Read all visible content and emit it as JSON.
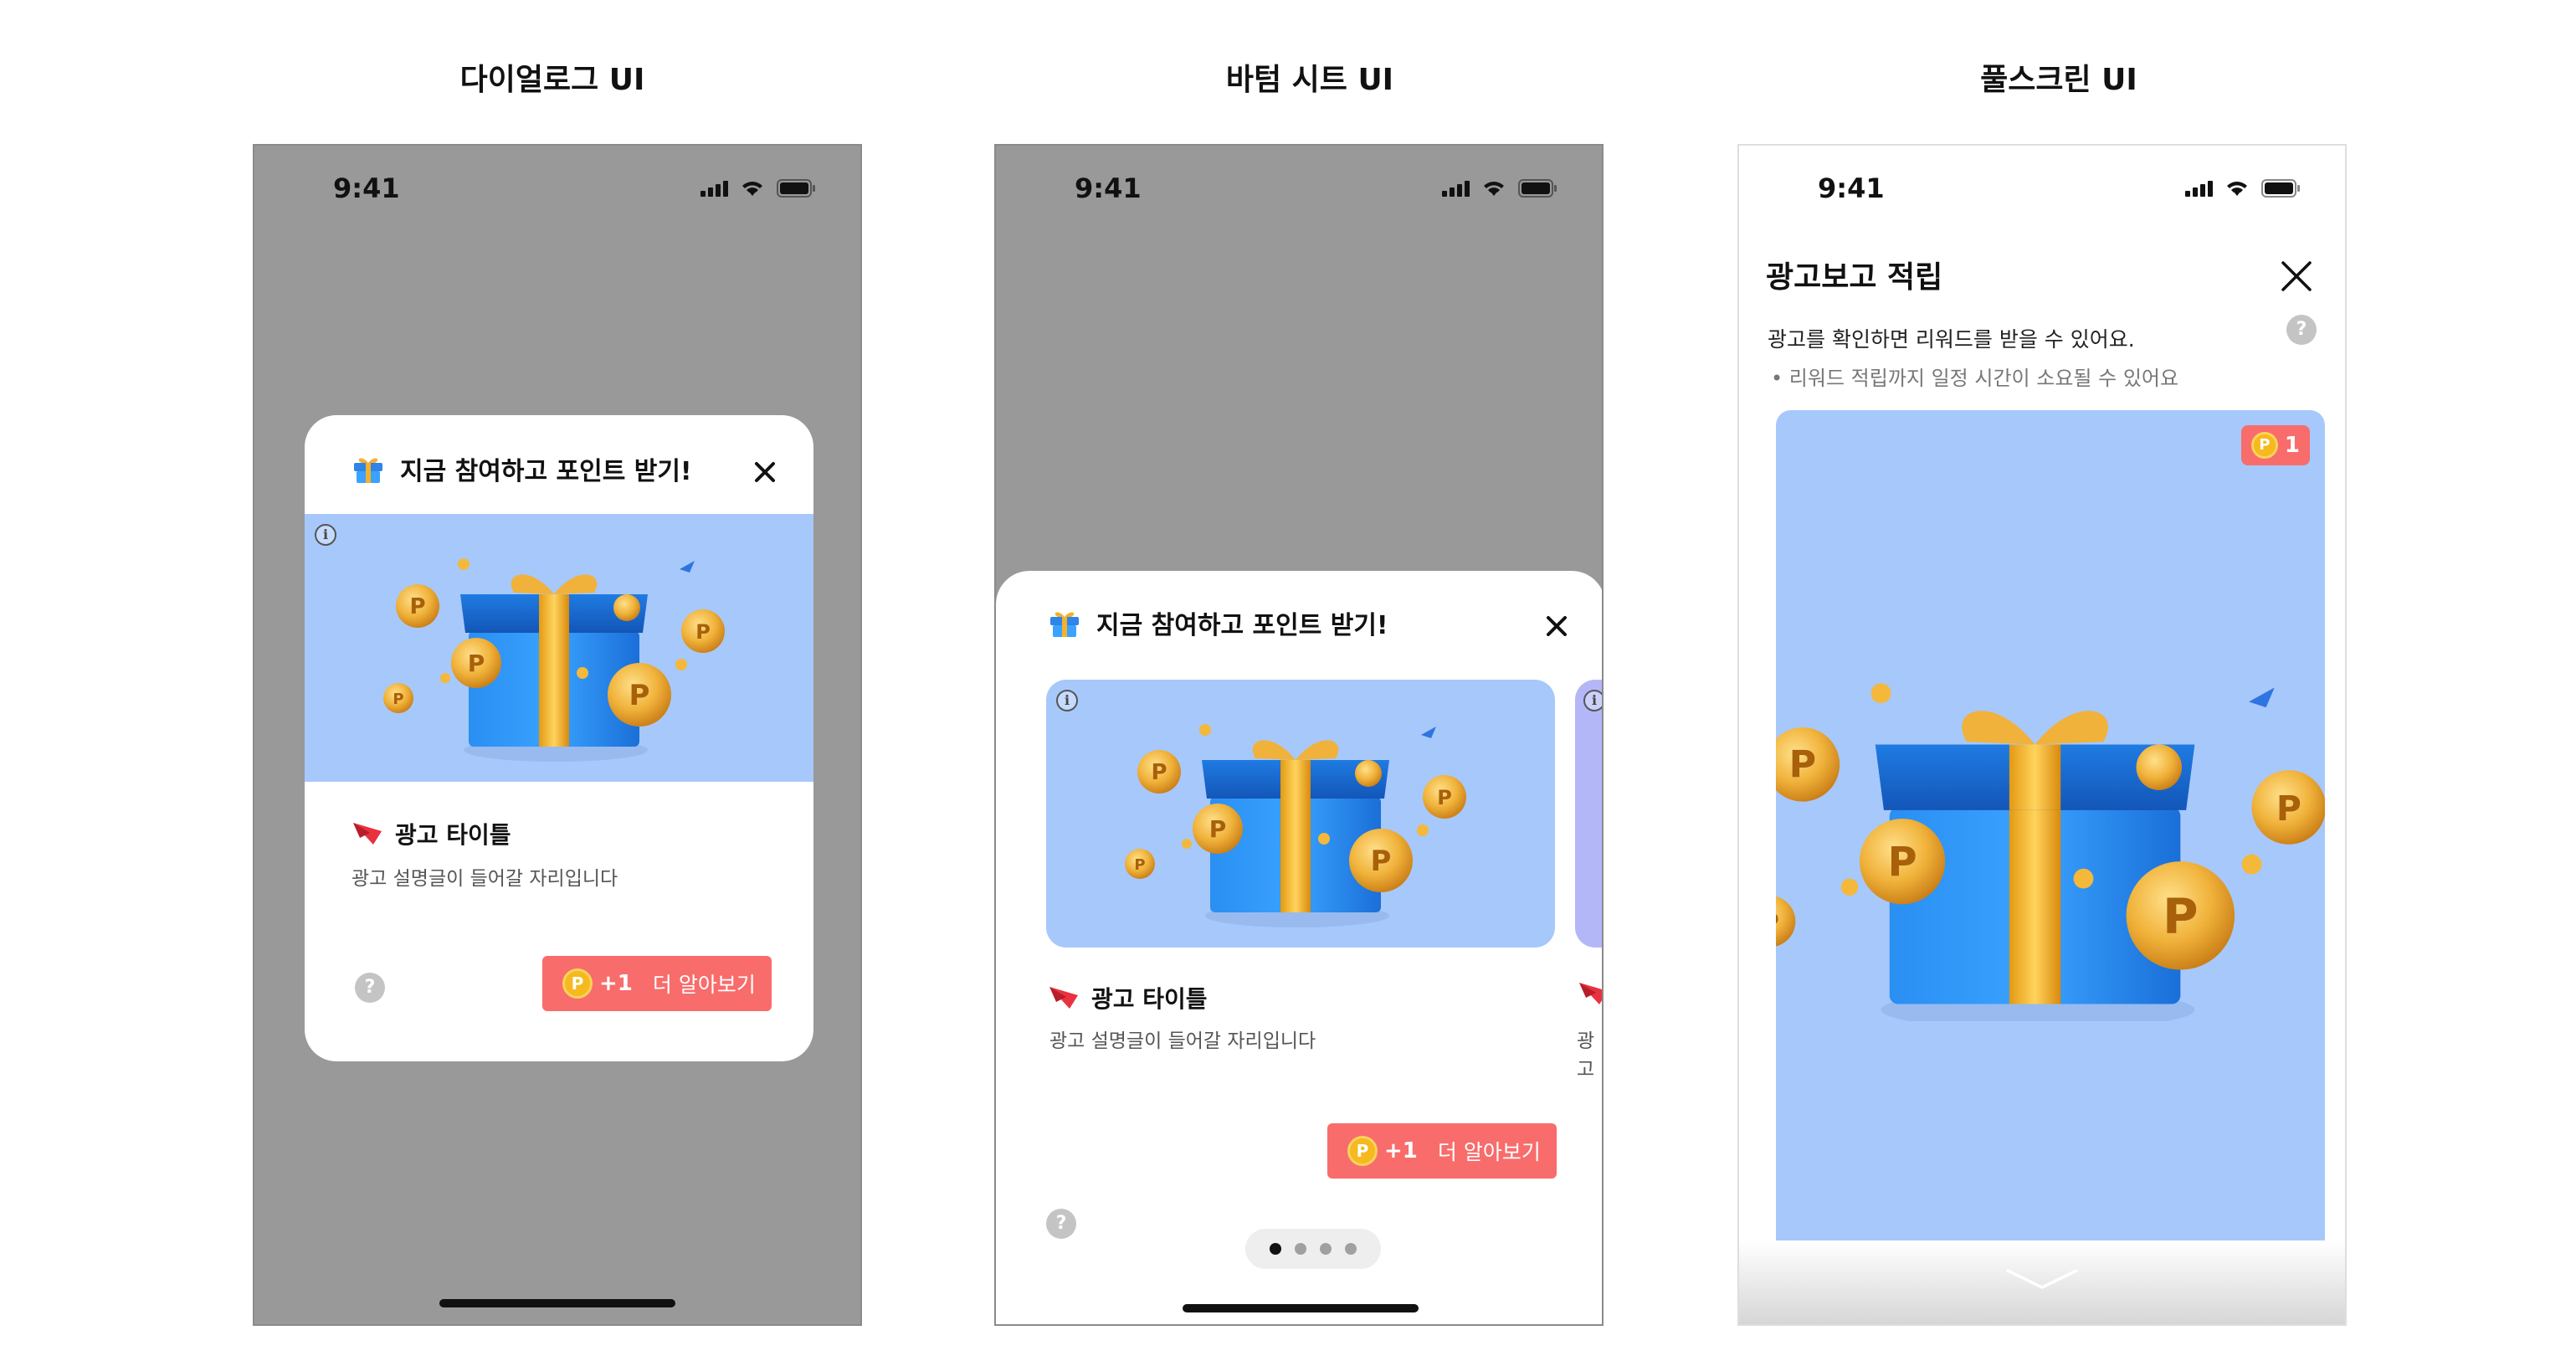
{
  "columns": [
    {
      "title": "다이얼로그 UI"
    },
    {
      "title": "바텀 시트 UI"
    },
    {
      "title": "풀스크린 UI"
    }
  ],
  "status_bar": {
    "time": "9:41"
  },
  "dialog": {
    "header_title": "지금 참여하고 포인트 받기!",
    "info_label": "i",
    "ad_title": "광고 타이틀",
    "ad_description": "광고 설명글이 들어갈 자리입니다",
    "help_label": "?",
    "cta": {
      "coin": "P",
      "points": "+1",
      "label": "더 알아보기"
    }
  },
  "bottom_sheet": {
    "header_title": "지금 참여하고 포인트 받기!",
    "info_label": "i",
    "ad_title": "광고 타이틀",
    "ad_description": "광고 설명글이 들어갈 자리입니다",
    "next_card_desc": "광고",
    "help_label": "?",
    "cta": {
      "coin": "P",
      "points": "+1",
      "label": "더 알아보기"
    },
    "pagination": {
      "total": 4,
      "active": 1
    }
  },
  "fullscreen": {
    "title": "광고보고 적립",
    "description": "광고를 확인하면 리워드를 받을 수 있어요.",
    "note": "• 리워드 적립까지 일정 시간이 소요될 수 있어요",
    "help_label": "?",
    "badge": {
      "coin": "P",
      "points": "1"
    }
  },
  "colors": {
    "dim_background": "#999999",
    "banner_blue": "#a7c8fb",
    "cta_red": "#f86c6c",
    "coin_gold": "#f6b91e",
    "gift_blue": "#1e7fe6",
    "ribbon_gold": "#f1a91b"
  },
  "icons": [
    "signal-icon",
    "wifi-icon",
    "battery-icon",
    "gift-icon",
    "close-icon",
    "info-icon",
    "brand-logo-icon",
    "help-icon",
    "coin-icon",
    "chevron-down-icon"
  ]
}
